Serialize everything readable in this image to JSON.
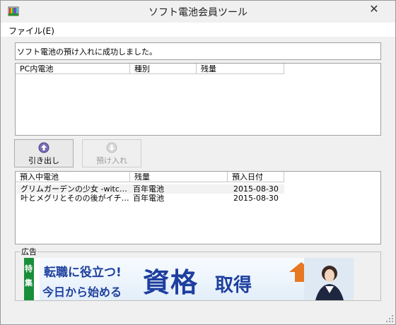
{
  "window": {
    "title": "ソフト電池会員ツール",
    "close_glyph": "✕"
  },
  "menu": {
    "file": "ファイル(E)"
  },
  "status_message": "ソフト電池の預け入れに成功しました。",
  "pc_list": {
    "columns": [
      "PC内電池",
      "種別",
      "残量"
    ],
    "rows": []
  },
  "buttons": {
    "withdraw": "引き出し",
    "deposit": "預け入れ"
  },
  "deposit_list": {
    "columns": [
      "預入中電池",
      "残量",
      "預入日付"
    ],
    "rows": [
      {
        "name": "グリムガーデンの少女 -witc…",
        "remaining": "百年電池",
        "date": "2015-08-30"
      },
      {
        "name": "叶とメグリとそのの後がイチ…",
        "remaining": "百年電池",
        "date": "2015-08-30"
      }
    ]
  },
  "ad": {
    "label": "広告",
    "tag": "特集",
    "line1": "転職に役立つ!",
    "line2": "今日から始める",
    "big1": "資格",
    "big2": "取得"
  },
  "colors": {
    "accent_blue": "#1d3f9e",
    "ad_green": "#1a8f3a",
    "ad_orange": "#e87722"
  }
}
